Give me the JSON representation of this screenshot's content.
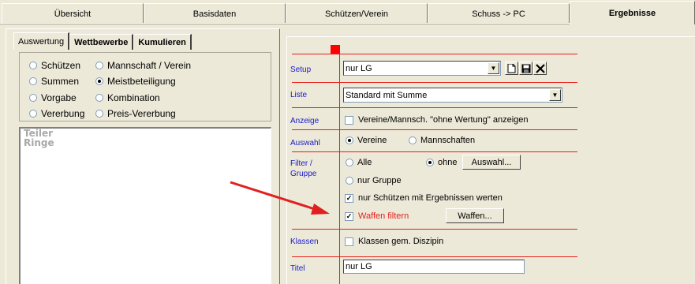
{
  "top_tabs": [
    "Übersicht",
    "Basisdaten",
    "Schützen/Verein",
    "Schuss -> PC",
    "Ergebnisse"
  ],
  "sub_tabs": [
    "Auswertung",
    "Wettbewerbe",
    "Kumulieren"
  ],
  "options": {
    "schuetzen": "Schützen",
    "mannschaft": "Mannschaft / Verein",
    "summen": "Summen",
    "meistbeteiligung": "Meistbeteiligung",
    "vorgabe": "Vorgabe",
    "kombination": "Kombination",
    "vererbung": "Vererbung",
    "preis_vererbung": "Preis-Vererbung",
    "selected": "Meistbeteiligung"
  },
  "list_items": [
    "Teiler",
    "Ringe"
  ],
  "right": {
    "setup_label": "Setup",
    "setup_value": "nur LG",
    "liste_label": "Liste",
    "liste_value": "Standard mit Summe",
    "anzeige_label": "Anzeige",
    "anzeige_check": "Vereine/Mannsch. \"ohne Wertung\" anzeigen",
    "auswahl_label": "Auswahl",
    "auswahl_vereine": "Vereine",
    "auswahl_mannschaften": "Mannschaften",
    "filter_label_1": "Filter /",
    "filter_label_2": "Gruppe",
    "filter_alle": "Alle",
    "filter_ohne": "ohne",
    "auswahl_button": "Auswahl...",
    "filter_nur_gruppe": "nur Gruppe",
    "nur_schuetzen": "nur Schützen mit Ergebnissen werten",
    "waffen_filtern": "Waffen filtern",
    "waffen_button": "Waffen...",
    "klassen_label": "Klassen",
    "klassen_check": "Klassen gem. Diszipin",
    "titel_label": "Titel",
    "titel_value": "nur LG"
  },
  "colors": {
    "accent_red": "#e81e1e",
    "label_blue": "#1a1ac8",
    "arrow_red": "#e02020"
  }
}
